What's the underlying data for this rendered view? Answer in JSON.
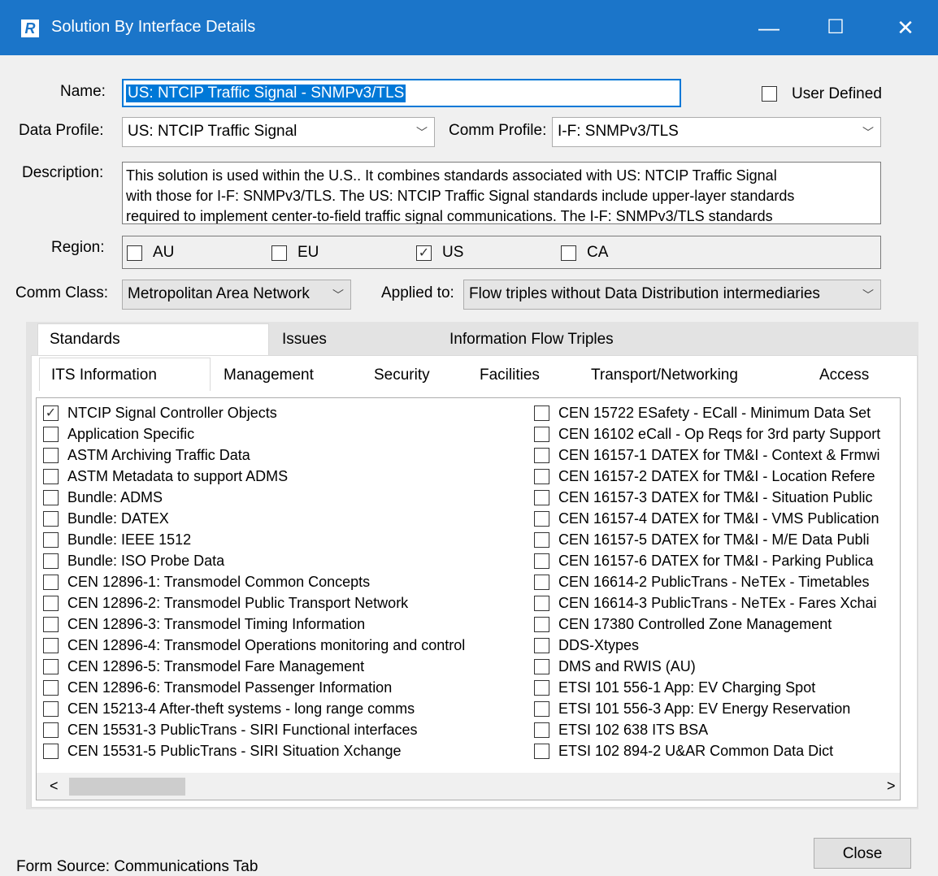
{
  "window": {
    "title": "Solution By Interface Details",
    "app_icon": "R",
    "minimize": "—",
    "maximize": "☐",
    "close": "✕"
  },
  "form": {
    "name_label": "Name:",
    "name_value": "US: NTCIP Traffic Signal - SNMPv3/TLS",
    "user_defined_label": "User Defined",
    "data_profile_label": "Data Profile:",
    "data_profile_value": "US: NTCIP Traffic Signal",
    "comm_profile_label": "Comm Profile:",
    "comm_profile_value": "I-F: SNMPv3/TLS",
    "description_label": "Description:",
    "description_lines": [
      "This solution is used within the U.S..  It combines standards associated with US: NTCIP Traffic Signal",
      "with those for I-F: SNMPv3/TLS. The US: NTCIP Traffic Signal standards include upper-layer standards",
      "required to implement center-to-field traffic signal communications.  The I-F: SNMPv3/TLS standards"
    ],
    "region_label": "Region:",
    "regions": [
      {
        "label": "AU",
        "checked": false
      },
      {
        "label": "EU",
        "checked": false
      },
      {
        "label": "US",
        "checked": true
      },
      {
        "label": "CA",
        "checked": false
      }
    ],
    "comm_class_label": "Comm Class:",
    "comm_class_value": "Metropolitan Area Network",
    "applied_to_label": "Applied to:",
    "applied_to_value": "Flow triples without Data Distribution intermediaries"
  },
  "tabs": {
    "outer": [
      "Standards",
      "Issues",
      "Information Flow Triples"
    ],
    "inner": [
      "ITS Information",
      "Management",
      "Security",
      "Facilities",
      "Transport/Networking",
      "Access"
    ]
  },
  "standards_left": [
    {
      "label": "NTCIP Signal Controller Objects",
      "checked": true
    },
    {
      "label": "Application Specific",
      "checked": false
    },
    {
      "label": "ASTM Archiving Traffic Data",
      "checked": false
    },
    {
      "label": "ASTM Metadata to support ADMS",
      "checked": false
    },
    {
      "label": "Bundle: ADMS",
      "checked": false
    },
    {
      "label": "Bundle: DATEX",
      "checked": false
    },
    {
      "label": "Bundle: IEEE 1512",
      "checked": false
    },
    {
      "label": "Bundle: ISO Probe Data",
      "checked": false
    },
    {
      "label": "CEN 12896-1: Transmodel Common Concepts",
      "checked": false
    },
    {
      "label": "CEN 12896-2: Transmodel Public Transport Network",
      "checked": false
    },
    {
      "label": "CEN 12896-3: Transmodel Timing Information",
      "checked": false
    },
    {
      "label": "CEN 12896-4: Transmodel Operations monitoring and control",
      "checked": false
    },
    {
      "label": "CEN 12896-5: Transmodel Fare Management",
      "checked": false
    },
    {
      "label": "CEN 12896-6: Transmodel Passenger Information",
      "checked": false
    },
    {
      "label": "CEN 15213-4 After-theft systems - long range comms",
      "checked": false
    },
    {
      "label": "CEN 15531-3 PublicTrans - SIRI Functional interfaces",
      "checked": false
    },
    {
      "label": "CEN 15531-5 PublicTrans - SIRI Situation Xchange",
      "checked": false
    }
  ],
  "standards_right": [
    {
      "label": "CEN 15722  ESafety - ECall - Minimum Data Set",
      "checked": false
    },
    {
      "label": "CEN 16102 eCall - Op Reqs for 3rd party Support",
      "checked": false
    },
    {
      "label": "CEN 16157-1 DATEX for TM&I - Context & Frmwi",
      "checked": false
    },
    {
      "label": "CEN 16157-2 DATEX for TM&I - Location Refere",
      "checked": false
    },
    {
      "label": "CEN 16157-3 DATEX for TM&I - Situation Public",
      "checked": false
    },
    {
      "label": "CEN 16157-4 DATEX for TM&I - VMS Publication",
      "checked": false
    },
    {
      "label": "CEN 16157-5 DATEX for TM&I - M/E Data Publi",
      "checked": false
    },
    {
      "label": "CEN 16157-6 DATEX for TM&I - Parking Publica",
      "checked": false
    },
    {
      "label": "CEN 16614-2 PublicTrans - NeTEx - Timetables",
      "checked": false
    },
    {
      "label": "CEN 16614-3 PublicTrans - NeTEx - Fares Xchai",
      "checked": false
    },
    {
      "label": "CEN 17380 Controlled Zone Management",
      "checked": false
    },
    {
      "label": "DDS-Xtypes",
      "checked": false
    },
    {
      "label": "DMS and RWIS (AU)",
      "checked": false
    },
    {
      "label": "ETSI 101 556-1 App: EV Charging Spot",
      "checked": false
    },
    {
      "label": "ETSI 101 556-3 App:  EV Energy Reservation",
      "checked": false
    },
    {
      "label": "ETSI 102 638 ITS BSA",
      "checked": false
    },
    {
      "label": "ETSI 102 894-2 U&AR Common Data Dict",
      "checked": false
    }
  ],
  "scroll": {
    "left_arrow": "<",
    "right_arrow": ">"
  },
  "footer": {
    "form_source": "Form Source: Communications Tab",
    "close_label": "Close"
  },
  "colors": {
    "titlebar": "#1b75c9",
    "selection": "#0078d7",
    "window_bg": "#f0f0f0"
  }
}
